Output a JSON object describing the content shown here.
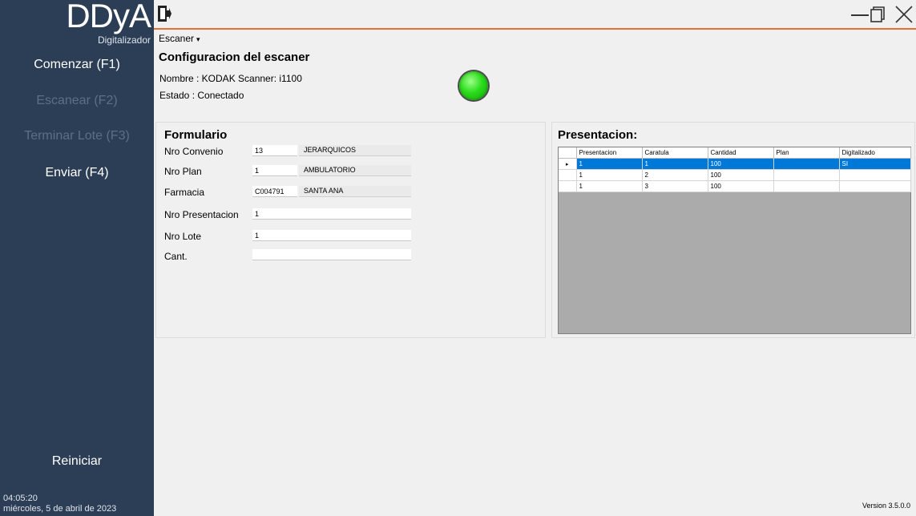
{
  "sidebar": {
    "logo": "DDyA",
    "subtitle": "Digitalizador",
    "buttons": {
      "start": "Comenzar (F1)",
      "scan": "Escanear (F2)",
      "finish": "Terminar Lote (F3)",
      "send": "Enviar (F4)",
      "restart": "Reiniciar"
    },
    "time": "04:05:20",
    "date": "miércoles, 5 de abril de 2023"
  },
  "menu": {
    "scanner": "Escaner"
  },
  "scanner": {
    "title": "Configuracion del escaner",
    "name": "Nombre : KODAK Scanner: i1100",
    "state": "Estado : Conectado",
    "status_color": "#2bdc1a"
  },
  "form": {
    "title": "Formulario",
    "labels": {
      "convenio": "Nro Convenio",
      "plan": "Nro Plan",
      "farmacia": "Farmacia",
      "presentacion": "Nro Presentacion",
      "lote": "Nro Lote",
      "cant": "Cant."
    },
    "values": {
      "convenio": "13",
      "convenio_desc": "JERARQUICOS",
      "plan": "1",
      "plan_desc": "AMBULATORIO",
      "farmacia": "C004791",
      "farmacia_desc": "SANTA ANA",
      "presentacion": "1",
      "lote": "1",
      "cant": ""
    }
  },
  "presentacion": {
    "title": "Presentacion:",
    "columns": [
      "Presentacion",
      "Caratula",
      "Cantidad",
      "Plan",
      "Digitalizado"
    ],
    "rows": [
      [
        "1",
        "1",
        "100",
        "",
        "SI"
      ],
      [
        "1",
        "2",
        "100",
        "",
        ""
      ],
      [
        "1",
        "3",
        "100",
        "",
        ""
      ]
    ],
    "selected_row": 0,
    "row_indicator": "▸"
  },
  "version": "Version 3.5.0.0",
  "colors": {
    "sidebar": "#2c3e55",
    "accent": "#e86e3a",
    "selection": "#0078d7"
  }
}
